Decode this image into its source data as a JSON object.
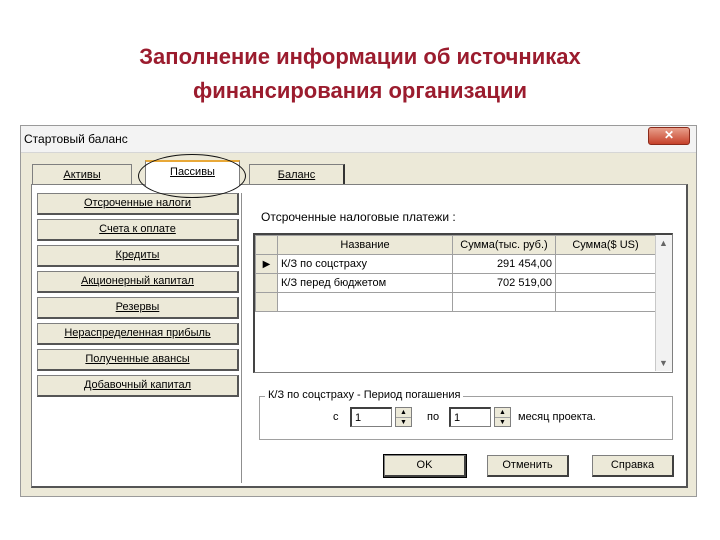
{
  "slide": {
    "title_line1": "Заполнение информации об источниках",
    "title_line2": "финансирования организации"
  },
  "window": {
    "title": "Стартовый баланс",
    "close_glyph": "✕"
  },
  "tabs": [
    {
      "label": "Активы"
    },
    {
      "label": "Пассивы",
      "active": true
    },
    {
      "label": "Баланс"
    }
  ],
  "categories": [
    {
      "label": "Отсроченные налоги",
      "active": true
    },
    {
      "label": "Счета к оплате"
    },
    {
      "label": "Кредиты"
    },
    {
      "label": "Акционерный капитал"
    },
    {
      "label": "Резервы"
    },
    {
      "label": "Нераспределенная прибыль"
    },
    {
      "label": "Полученные авансы"
    },
    {
      "label": "Добавочный капитал"
    }
  ],
  "section_caption": "Отсроченные налоговые платежи :",
  "grid": {
    "columns": [
      "Название",
      "Сумма(тыс. руб.)",
      "Сумма($ US)"
    ],
    "rows": [
      {
        "indicator": "▶",
        "name": "К/З по соцстраху",
        "rub": "291 454,00",
        "usd": ""
      },
      {
        "indicator": "",
        "name": "К/З перед бюджетом",
        "rub": "702 519,00",
        "usd": ""
      },
      {
        "indicator": "",
        "name": "",
        "rub": "",
        "usd": ""
      }
    ]
  },
  "period": {
    "legend": "К/З по соцстраху - Период погашения",
    "from_label": "с",
    "from_value": "1",
    "to_label": "по",
    "to_value": "1",
    "unit_label": "месяц проекта."
  },
  "buttons": {
    "ok": "OK",
    "cancel": "Отменить",
    "help": "Справка"
  },
  "colors": {
    "title": "#9b1c2e",
    "window_bg": "#ece9d8"
  }
}
